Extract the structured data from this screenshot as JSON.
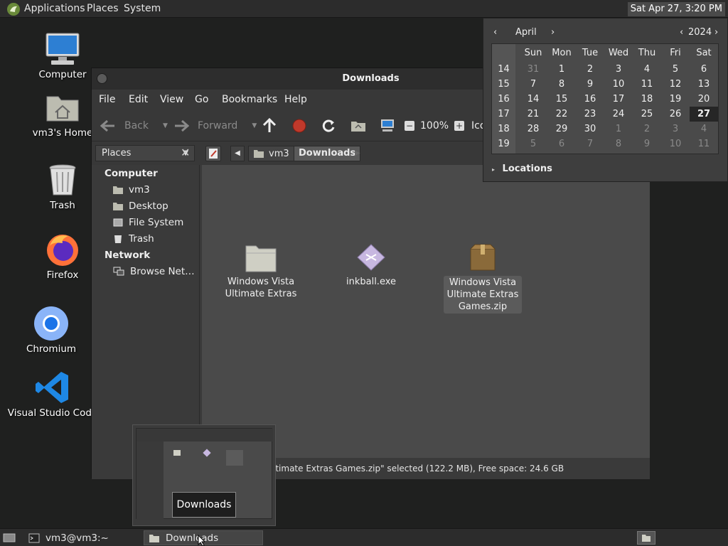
{
  "top_panel": {
    "menus": [
      "Applications",
      "Places",
      "System"
    ],
    "clock": "Sat Apr 27,  3:20 PM"
  },
  "desktop_icons": [
    {
      "label": "Computer",
      "icon": "computer-icon"
    },
    {
      "label": "vm3's Home",
      "icon": "home-folder-icon"
    },
    {
      "label": "Trash",
      "icon": "trash-icon"
    },
    {
      "label": "Firefox",
      "icon": "firefox-icon"
    },
    {
      "label": "Chromium",
      "icon": "chromium-icon"
    },
    {
      "label": "Visual Studio Code",
      "icon": "vscode-icon"
    }
  ],
  "file_manager": {
    "title": "Downloads",
    "menubar": [
      "File",
      "Edit",
      "View",
      "Go",
      "Bookmarks",
      "Help"
    ],
    "toolbar": {
      "back": "Back",
      "forward": "Forward",
      "zoom": "100%",
      "view_mode": "Ico"
    },
    "places_dropdown": "Places",
    "breadcrumbs": [
      "vm3",
      "Downloads"
    ],
    "sidebar": {
      "computer_heading": "Computer",
      "computer_items": [
        "vm3",
        "Desktop",
        "File System",
        "Trash"
      ],
      "network_heading": "Network",
      "network_items": [
        "Browse Net…"
      ]
    },
    "files": [
      {
        "name": "Windows Vista Ultimate Extras",
        "icon": "folder-icon",
        "selected": false
      },
      {
        "name": "inkball.exe",
        "icon": "executable-icon",
        "selected": false
      },
      {
        "name": "Windows Vista Ultimate Extras Games.zip",
        "icon": "zip-archive-icon",
        "selected": true
      }
    ],
    "status": "itimate Extras Games.zip\" selected (122.2 MB), Free space: 24.6 GB"
  },
  "calendar": {
    "month": "April",
    "year": "2024",
    "day_names": [
      "Sun",
      "Mon",
      "Tue",
      "Wed",
      "Thu",
      "Fri",
      "Sat"
    ],
    "weeks": [
      {
        "num": "14",
        "days": [
          "31",
          "1",
          "2",
          "3",
          "4",
          "5",
          "6"
        ]
      },
      {
        "num": "15",
        "days": [
          "7",
          "8",
          "9",
          "10",
          "11",
          "12",
          "13"
        ]
      },
      {
        "num": "16",
        "days": [
          "14",
          "15",
          "16",
          "17",
          "18",
          "19",
          "20"
        ]
      },
      {
        "num": "17",
        "days": [
          "21",
          "22",
          "23",
          "24",
          "25",
          "26",
          "27"
        ]
      },
      {
        "num": "18",
        "days": [
          "28",
          "29",
          "30",
          "1",
          "2",
          "3",
          "4"
        ]
      },
      {
        "num": "19",
        "days": [
          "5",
          "6",
          "7",
          "8",
          "9",
          "10",
          "11"
        ]
      }
    ],
    "today": "27",
    "locations_label": "Locations"
  },
  "taskbar": {
    "terminal": "vm3@vm3:~",
    "downloads": "Downloads",
    "preview_label": "Downloads"
  },
  "colors": {
    "desktop_bg": "#1f201f",
    "panel": "#2c2c2c",
    "window_bg": "#3a3a3a",
    "content_bg": "#4a4a4a",
    "stop_red": "#c0392b",
    "vscode_blue": "#1e88e5"
  }
}
